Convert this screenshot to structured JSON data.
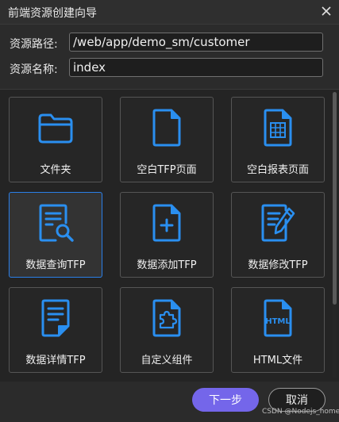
{
  "window": {
    "title": "前端资源创建向导"
  },
  "form": {
    "path_label": "资源路径:",
    "path_value": "/web/app/demo_sm/customer",
    "name_label": "资源名称:",
    "name_value": "index"
  },
  "cards": [
    {
      "label": "文件夹",
      "icon": "folder-icon",
      "selected": false
    },
    {
      "label": "空白TFP页面",
      "icon": "blank-page-icon",
      "selected": false
    },
    {
      "label": "空白报表页面",
      "icon": "report-page-icon",
      "selected": false
    },
    {
      "label": "数据查询TFP",
      "icon": "data-query-icon",
      "selected": true
    },
    {
      "label": "数据添加TFP",
      "icon": "data-add-icon",
      "selected": false
    },
    {
      "label": "数据修改TFP",
      "icon": "data-edit-icon",
      "selected": false
    },
    {
      "label": "数据详情TFP",
      "icon": "data-detail-icon",
      "selected": false
    },
    {
      "label": "自定义组件",
      "icon": "custom-component-icon",
      "selected": false
    },
    {
      "label": "HTML文件",
      "icon": "html-file-icon",
      "selected": false
    }
  ],
  "html_badge": "HTML",
  "buttons": {
    "next": "下一步",
    "cancel": "取消"
  },
  "watermark": "CSDN @Nodejs_home",
  "colors": {
    "accent": "#2a8ff0",
    "selected_border": "#2a7fe8",
    "primary_button": "#7466ea"
  }
}
